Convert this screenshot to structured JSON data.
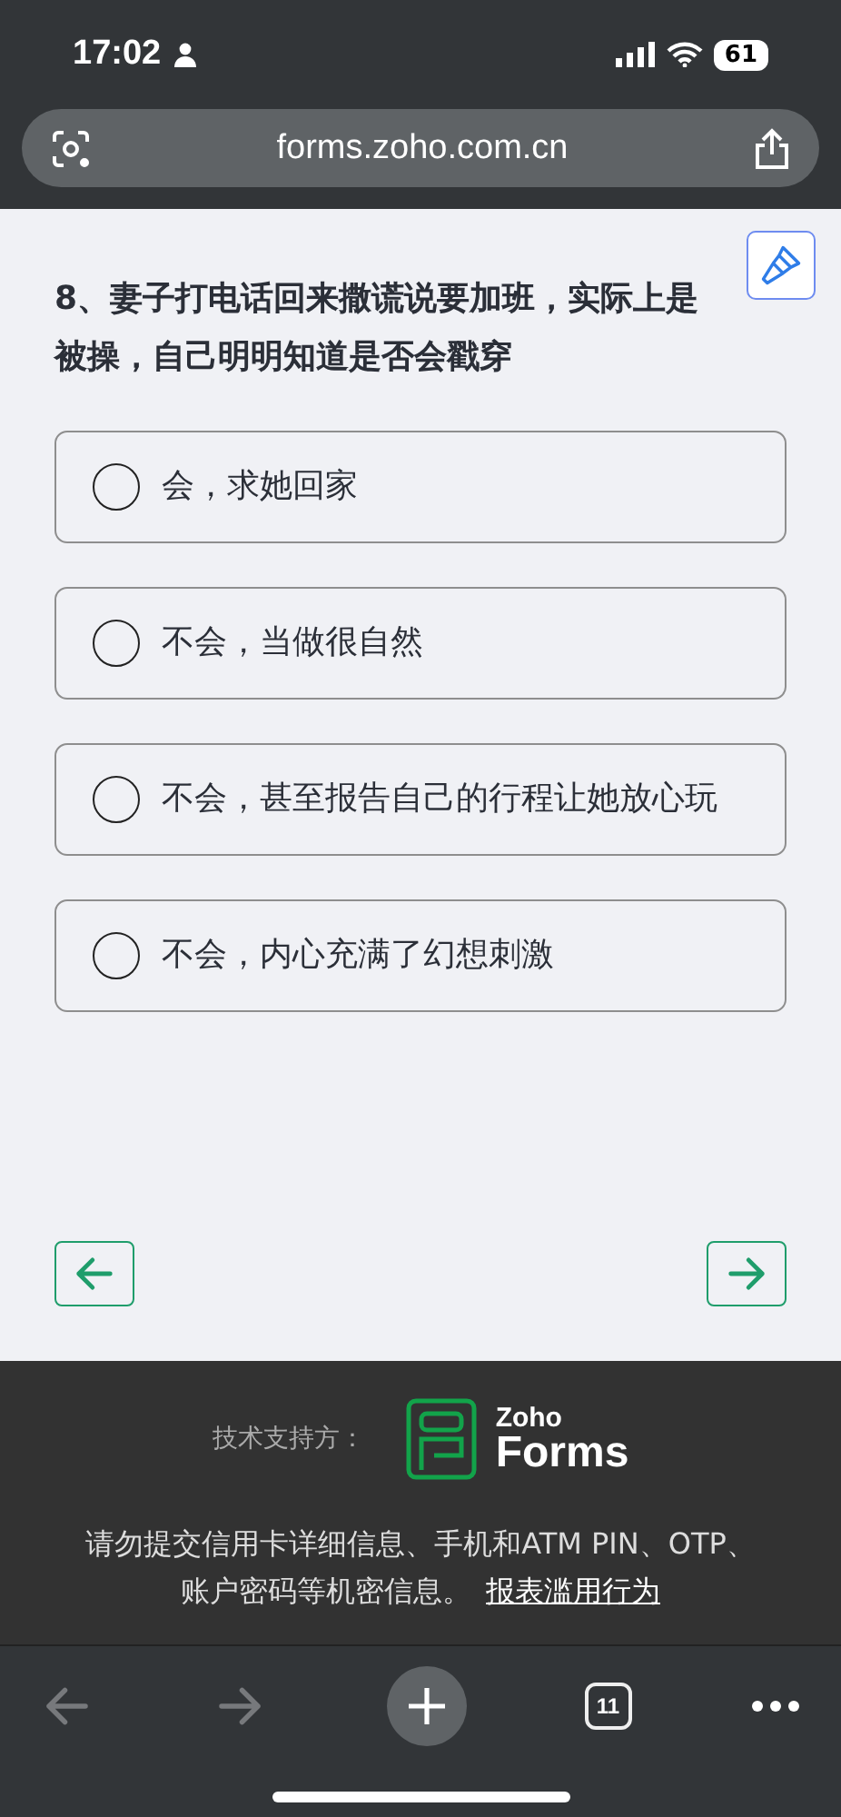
{
  "status_bar": {
    "time": "17:02",
    "battery": "61"
  },
  "address_bar": {
    "url": "forms.zoho.com.cn"
  },
  "question": {
    "text": "8、妻子打电话回来撒谎说要加班，实际上是被操，自己明明知道是否会戳穿"
  },
  "options": [
    {
      "label": "会，求她回家",
      "selected": false
    },
    {
      "label": "不会，当做很自然",
      "selected": false
    },
    {
      "label": "不会，甚至报告自己的行程让她放心玩",
      "selected": false
    },
    {
      "label": "不会，内心充满了幻想刺激",
      "selected": false
    }
  ],
  "footer": {
    "powered_by": "技术支持方：",
    "logo_small": "Zoho",
    "logo_big": "Forms",
    "notice": "请勿提交信用卡详细信息、手机和ATM PIN、OTP、账户密码等机密信息。",
    "report_link": "报表滥用行为"
  },
  "toolbar": {
    "back_disabled": true,
    "forward_disabled": true,
    "tab_count": "11"
  }
}
